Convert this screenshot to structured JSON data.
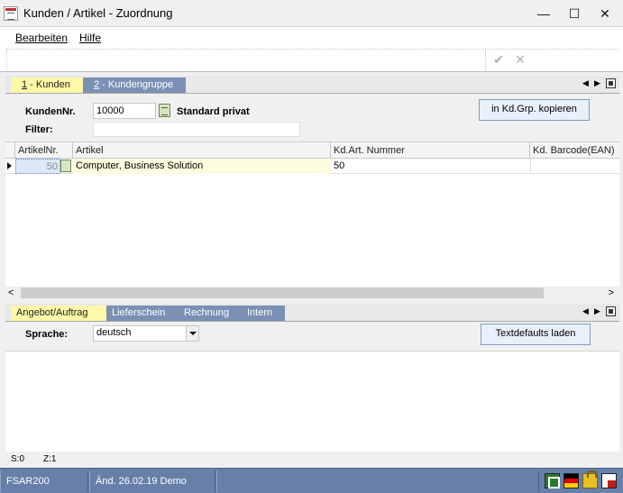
{
  "window": {
    "title": "Kunden / Artikel  - Zuordnung",
    "controls": {
      "minimize": "—",
      "maximize": "☐",
      "close": "✕"
    }
  },
  "menu": {
    "items": [
      "Bearbeiten",
      "Hilfe"
    ],
    "toolbar_icons": [
      "check-icon",
      "x-icon"
    ]
  },
  "tabs_top": [
    {
      "num": "1",
      "label": " - Kunden",
      "active": true
    },
    {
      "num": "2",
      "label": " - Kundengruppe",
      "active": false
    }
  ],
  "form": {
    "kunden_label": "KundenNr.",
    "kunden_value": "10000",
    "customer_name": "Standard privat",
    "filter_label": "Filter:",
    "filter_value": "",
    "copy_button": "in Kd.Grp. kopieren"
  },
  "grid": {
    "columns": [
      "ArtikelNr.",
      "Artikel",
      "Kd.Art. Nummer",
      "Kd. Barcode(EAN)"
    ],
    "rows": [
      {
        "artikelnr": "50",
        "artikel": "Computer, Business Solution",
        "kdart": "50",
        "barcode": ""
      }
    ]
  },
  "tabs_bottom": [
    {
      "label": "Angebot/Auftrag",
      "active": true
    },
    {
      "label": "Lieferschein",
      "active": false
    },
    {
      "label": "Rechnung",
      "active": false
    },
    {
      "label": "Intern",
      "active": false
    }
  ],
  "text_panel": {
    "sprache_label": "Sprache:",
    "sprache_value": "deutsch",
    "load_button": "Textdefaults laden",
    "stats_s": "S:0",
    "stats_z": "Z:1"
  },
  "statusbar": {
    "program": "FSAR200",
    "changed": "Änd. 26.02.19 Demo",
    "info": "",
    "icons": [
      "excel-icon",
      "german-flag-icon",
      "lock-icon",
      "page-icon"
    ]
  },
  "colors": {
    "tab_active": "#fff8a8",
    "tab_inactive": "#7b90b5",
    "statusbar": "#6680aa"
  }
}
